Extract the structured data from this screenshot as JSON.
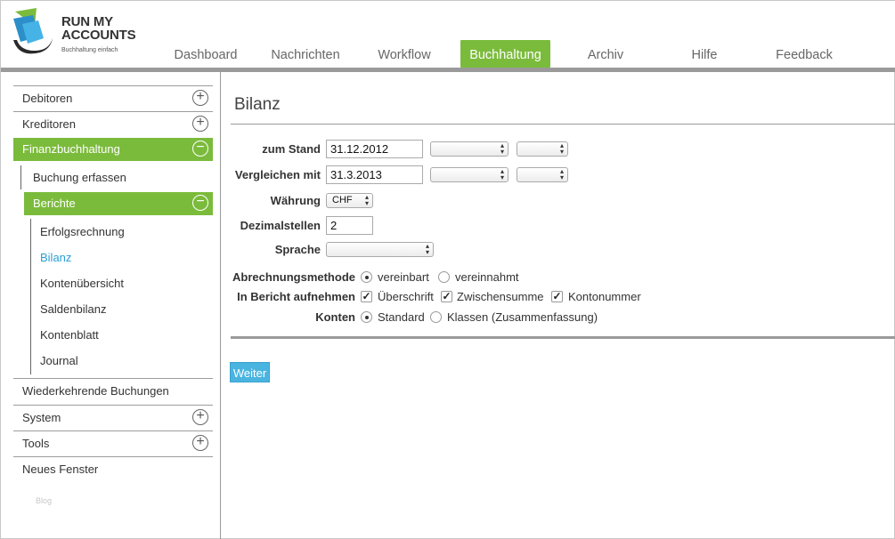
{
  "brand": {
    "title_line1": "RUN MY",
    "title_line2": "ACCOUNTS",
    "tagline": "Buchhaltung einfach"
  },
  "nav": {
    "items": [
      {
        "label": "Dashboard",
        "active": false
      },
      {
        "label": "Nachrichten",
        "active": false
      },
      {
        "label": "Workflow",
        "active": false
      },
      {
        "label": "Buchhaltung",
        "active": true
      },
      {
        "label": "Archiv",
        "active": false
      },
      {
        "label": "Hilfe",
        "active": false
      },
      {
        "label": "Feedback",
        "active": false
      }
    ]
  },
  "sidebar": {
    "debitoren": "Debitoren",
    "kreditoren": "Kreditoren",
    "finanzbuchhaltung": "Finanzbuchhaltung",
    "buchung_erfassen": "Buchung erfassen",
    "berichte": "Berichte",
    "reports": [
      {
        "label": "Erfolgsrechnung",
        "active": false
      },
      {
        "label": "Bilanz",
        "active": true
      },
      {
        "label": "Kontenübersicht",
        "active": false
      },
      {
        "label": "Saldenbilanz",
        "active": false
      },
      {
        "label": "Kontenblatt",
        "active": false
      },
      {
        "label": "Journal",
        "active": false
      }
    ],
    "wiederkehrende": "Wiederkehrende Buchungen",
    "system": "System",
    "tools": "Tools",
    "neues_fenster": "Neues Fenster",
    "blog": "Blog"
  },
  "main": {
    "title": "Bilanz",
    "form": {
      "zum_stand_label": "zum Stand",
      "zum_stand_value": "31.12.2012",
      "vergleichen_label": "Vergleichen mit",
      "vergleichen_value": "31.3.2013",
      "waehrung_label": "Währung",
      "waehrung_value": "CHF",
      "dezimal_label": "Dezimalstellen",
      "dezimal_value": "2",
      "sprache_label": "Sprache",
      "sprache_value": "",
      "methode_label": "Abrechnungsmethode",
      "methode_options": [
        {
          "label": "vereinbart",
          "selected": true
        },
        {
          "label": "vereinnahmt",
          "selected": false
        }
      ],
      "bericht_label": "In Bericht aufnehmen",
      "bericht_options": [
        {
          "label": "Überschrift",
          "checked": true
        },
        {
          "label": "Zwischensumme",
          "checked": true
        },
        {
          "label": "Kontonummer",
          "checked": true
        }
      ],
      "konten_label": "Konten",
      "konten_options": [
        {
          "label": "Standard",
          "selected": true
        },
        {
          "label": "Klassen (Zusammenfassung)",
          "selected": false
        }
      ]
    },
    "submit_label": "Weiter"
  },
  "colors": {
    "accent_green": "#7bbb3c",
    "link_blue": "#2a9fd6",
    "button_blue": "#4ab4e0"
  }
}
